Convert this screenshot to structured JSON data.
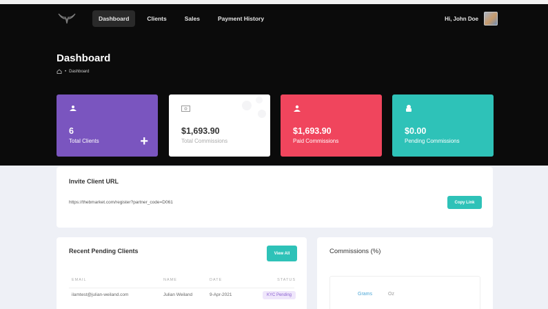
{
  "nav": {
    "links": [
      "Dashboard",
      "Clients",
      "Sales",
      "Payment History"
    ],
    "user": "Hi, John Doe"
  },
  "page": {
    "title": "Dashboard",
    "breadcrumb": "Dashboard"
  },
  "stats": [
    {
      "value": "6",
      "label": "Total Clients",
      "icon": "users-icon"
    },
    {
      "value": "$1,693.90",
      "label": "Total Commissions",
      "icon": "money-icon"
    },
    {
      "value": "$1,693.90",
      "label": "Paid Commissions",
      "icon": "user-check-icon"
    },
    {
      "value": "$0.00",
      "label": "Pending Commissions",
      "icon": "lock-user-icon"
    }
  ],
  "invite": {
    "title": "Invite Client URL",
    "url": "https://thebmarket.com/register?partner_code=D061",
    "button": "Copy Link"
  },
  "pending": {
    "title": "Recent Pending Clients",
    "button": "View All",
    "columns": [
      "EMAIL",
      "NAME",
      "DATE",
      "STATUS"
    ],
    "rows": [
      {
        "email": "ilamtest@julian-weiland.com",
        "name": "Julian Weiland",
        "date": "9-Apr-2021",
        "status": "KYC Pending"
      }
    ]
  },
  "commissions": {
    "title": "Commissions (%)",
    "tabs": [
      "Grams",
      "Oz"
    ]
  },
  "colors": {
    "purple": "#7a55bf",
    "red": "#f0455d",
    "teal": "#2ec2b8",
    "hero": "#0b0b0b"
  }
}
